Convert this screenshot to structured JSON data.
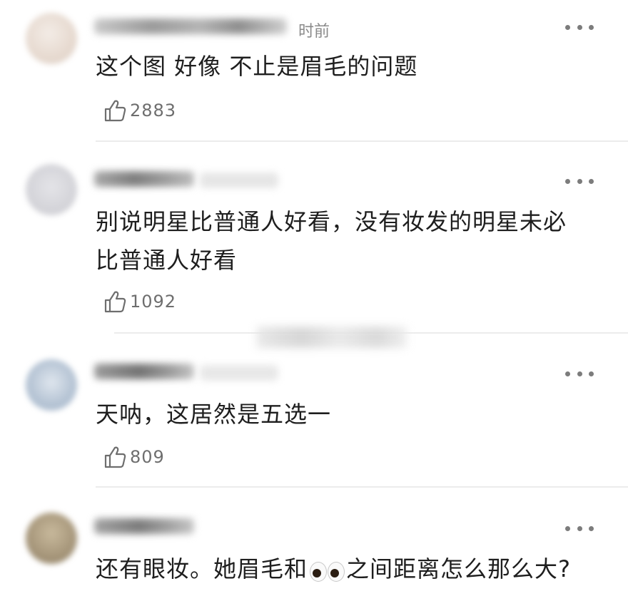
{
  "comments": [
    {
      "time_fragment": "时前",
      "text": "这个图 好像 不止是眉毛的问题",
      "likes": "2883",
      "avatar_color": "#e8ddd6"
    },
    {
      "text": "别说明星比普通人好看，没有妆发的明星未必比普通人好看",
      "likes": "1092",
      "avatar_color": "#d6d6da"
    },
    {
      "text": "天呐，这居然是五选一",
      "likes": "809",
      "avatar_color": "#b9c6d6"
    },
    {
      "text_before_emoji": "还有眼妆。她眉毛和",
      "emoji": "eyes-emoji",
      "text_after_emoji": "之间距离怎么那么大?",
      "avatar_color": "#a8987c"
    }
  ],
  "icons": {
    "like": "thumbs-up-outline-icon",
    "more": "more-dots-icon"
  }
}
